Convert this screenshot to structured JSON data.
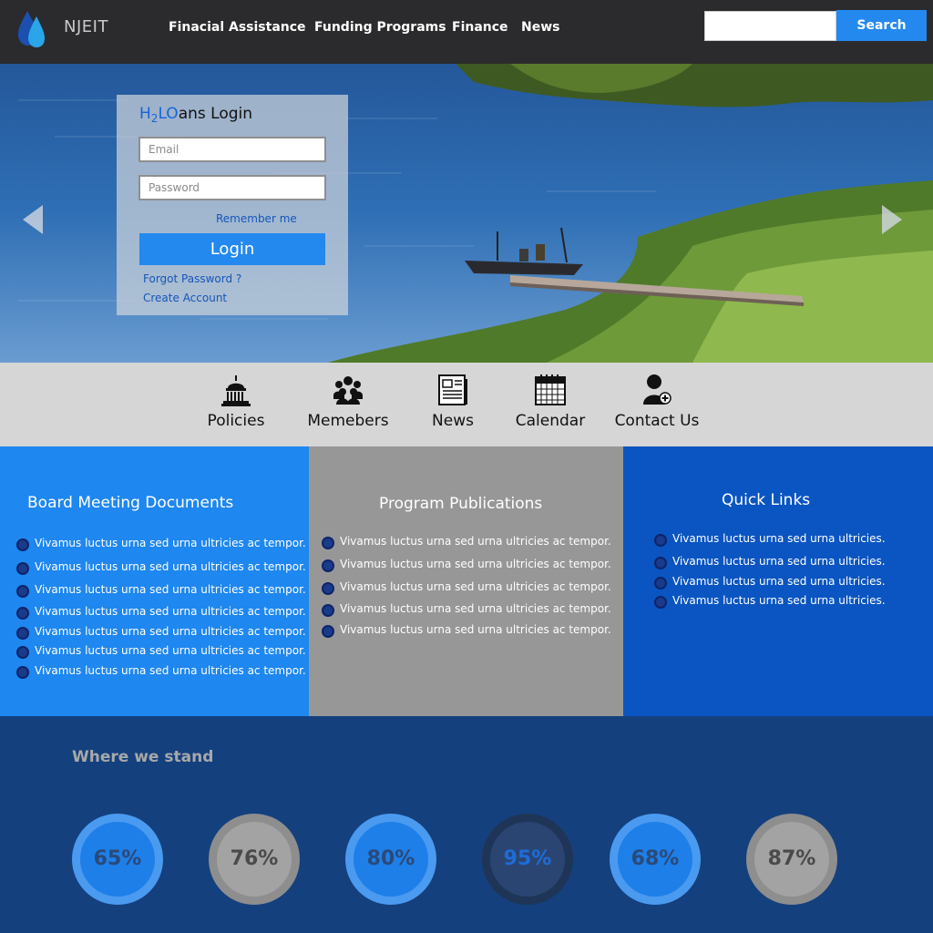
{
  "header": {
    "brand": "NJEIT",
    "nav": [
      "Finacial Assistance",
      "Funding Programs",
      "Finance",
      "News"
    ],
    "search_placeholder": "",
    "search_button": "Search"
  },
  "login": {
    "title_h": "H",
    "title_sub": "2",
    "title_o": "LO",
    "title_rest": "ans Login",
    "email_placeholder": "Email",
    "password_placeholder": "Password",
    "remember": "Remember me",
    "button": "Login",
    "forgot": "Forgot Password ?",
    "create": "Create Account"
  },
  "iconbar": {
    "items": [
      {
        "label": "Policies",
        "icon": "capitol-icon"
      },
      {
        "label": "Memebers",
        "icon": "group-icon"
      },
      {
        "label": "News",
        "icon": "newspaper-icon"
      },
      {
        "label": "Calendar",
        "icon": "calendar-icon"
      },
      {
        "label": "Contact Us",
        "icon": "contact-add-icon"
      }
    ]
  },
  "columns": [
    {
      "title": "Board Meeting Documents",
      "items": [
        "Vivamus luctus urna sed urna ultricies ac tempor.",
        "Vivamus luctus urna sed urna ultricies ac tempor.",
        "Vivamus luctus urna sed urna ultricies ac tempor.",
        "Vivamus luctus urna sed urna ultricies ac tempor.",
        "Vivamus luctus urna sed urna ultricies ac tempor.",
        "Vivamus luctus urna sed urna ultricies ac tempor.",
        "Vivamus luctus urna sed urna ultricies ac tempor."
      ]
    },
    {
      "title": "Program Publications",
      "items": [
        "Vivamus luctus urna sed urna ultricies ac tempor.",
        "Vivamus luctus urna sed urna ultricies ac tempor.",
        "Vivamus luctus urna sed urna ultricies ac tempor.",
        "Vivamus luctus urna sed urna ultricies ac tempor.",
        "Vivamus luctus urna sed urna ultricies ac tempor."
      ]
    },
    {
      "title": "Quick Links",
      "items": [
        "Vivamus luctus urna sed urna ultricies.",
        "Vivamus luctus urna sed urna ultricies.",
        "Vivamus luctus urna sed urna ultricies.",
        "Vivamus luctus urna sed urna ultricies."
      ]
    }
  ],
  "stats": {
    "title": "Where we stand",
    "items": [
      {
        "value": "65%",
        "ring": "#4a9af0",
        "fill": "#1e7fe8",
        "text": "#2a4a7a"
      },
      {
        "value": "76%",
        "ring": "#8e8e8e",
        "fill": "#a3a3a3",
        "text": "#4a4a4a"
      },
      {
        "value": "80%",
        "ring": "#4a9af0",
        "fill": "#1e7fe8",
        "text": "#2a4a7a"
      },
      {
        "value": "95%",
        "ring": "#1f3558",
        "fill": "#2a4572",
        "text": "#1e6cd8"
      },
      {
        "value": "68%",
        "ring": "#4a9af0",
        "fill": "#1e7fe8",
        "text": "#2a4a7a"
      },
      {
        "value": "87%",
        "ring": "#8e8e8e",
        "fill": "#a3a3a3",
        "text": "#4a4a4a"
      }
    ]
  },
  "colors": {
    "accent": "#2489ee",
    "header_bg": "#2b2b2d",
    "footer_bg": "#14407e"
  }
}
